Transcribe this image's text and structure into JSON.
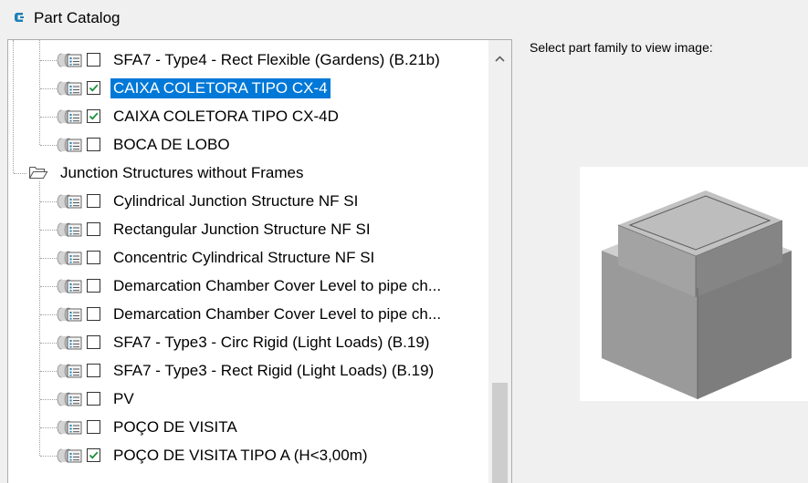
{
  "window": {
    "title": "Part Catalog",
    "icon": "civil3d-app-icon"
  },
  "tree": {
    "rows": [
      {
        "label": "SFA7 - Type4 - Rect Flexible (Gardens) (B.21b)",
        "type": "part",
        "checked": false,
        "selected": false
      },
      {
        "label": "CAIXA COLETORA TIPO CX-4",
        "type": "part",
        "checked": true,
        "selected": true
      },
      {
        "label": "CAIXA COLETORA TIPO CX-4D",
        "type": "part",
        "checked": true,
        "selected": false
      },
      {
        "label": "BOCA DE LOBO",
        "type": "part",
        "checked": false,
        "selected": false
      },
      {
        "label": "Junction Structures without Frames",
        "type": "folder",
        "expanded": true
      },
      {
        "label": "Cylindrical Junction Structure NF SI",
        "type": "part",
        "checked": false,
        "selected": false
      },
      {
        "label": "Rectangular Junction Structure NF SI",
        "type": "part",
        "checked": false,
        "selected": false
      },
      {
        "label": "Concentric Cylindrical Structure NF SI",
        "type": "part",
        "checked": false,
        "selected": false
      },
      {
        "label": "Demarcation Chamber  Cover Level to pipe ch...",
        "type": "part",
        "checked": false,
        "selected": false
      },
      {
        "label": "Demarcation Chamber  Cover Level to pipe ch...",
        "type": "part",
        "checked": false,
        "selected": false
      },
      {
        "label": "SFA7 - Type3 - Circ Rigid (Light Loads) (B.19)",
        "type": "part",
        "checked": false,
        "selected": false
      },
      {
        "label": "SFA7 - Type3 - Rect Rigid (Light Loads) (B.19)",
        "type": "part",
        "checked": false,
        "selected": false
      },
      {
        "label": "PV",
        "type": "part",
        "checked": false,
        "selected": false
      },
      {
        "label": "POÇO DE VISITA",
        "type": "part",
        "checked": false,
        "selected": false
      },
      {
        "label": "POÇO DE VISITA TIPO A (H<3,00m)",
        "type": "part",
        "checked": true,
        "selected": false
      }
    ]
  },
  "preview": {
    "label": "Select part family to view image:",
    "image": "junction-box-3d-preview"
  },
  "colors": {
    "selection": "#0078d7",
    "check": "#1a8f3a",
    "background": "#f0f0f0",
    "border": "#adadad"
  }
}
